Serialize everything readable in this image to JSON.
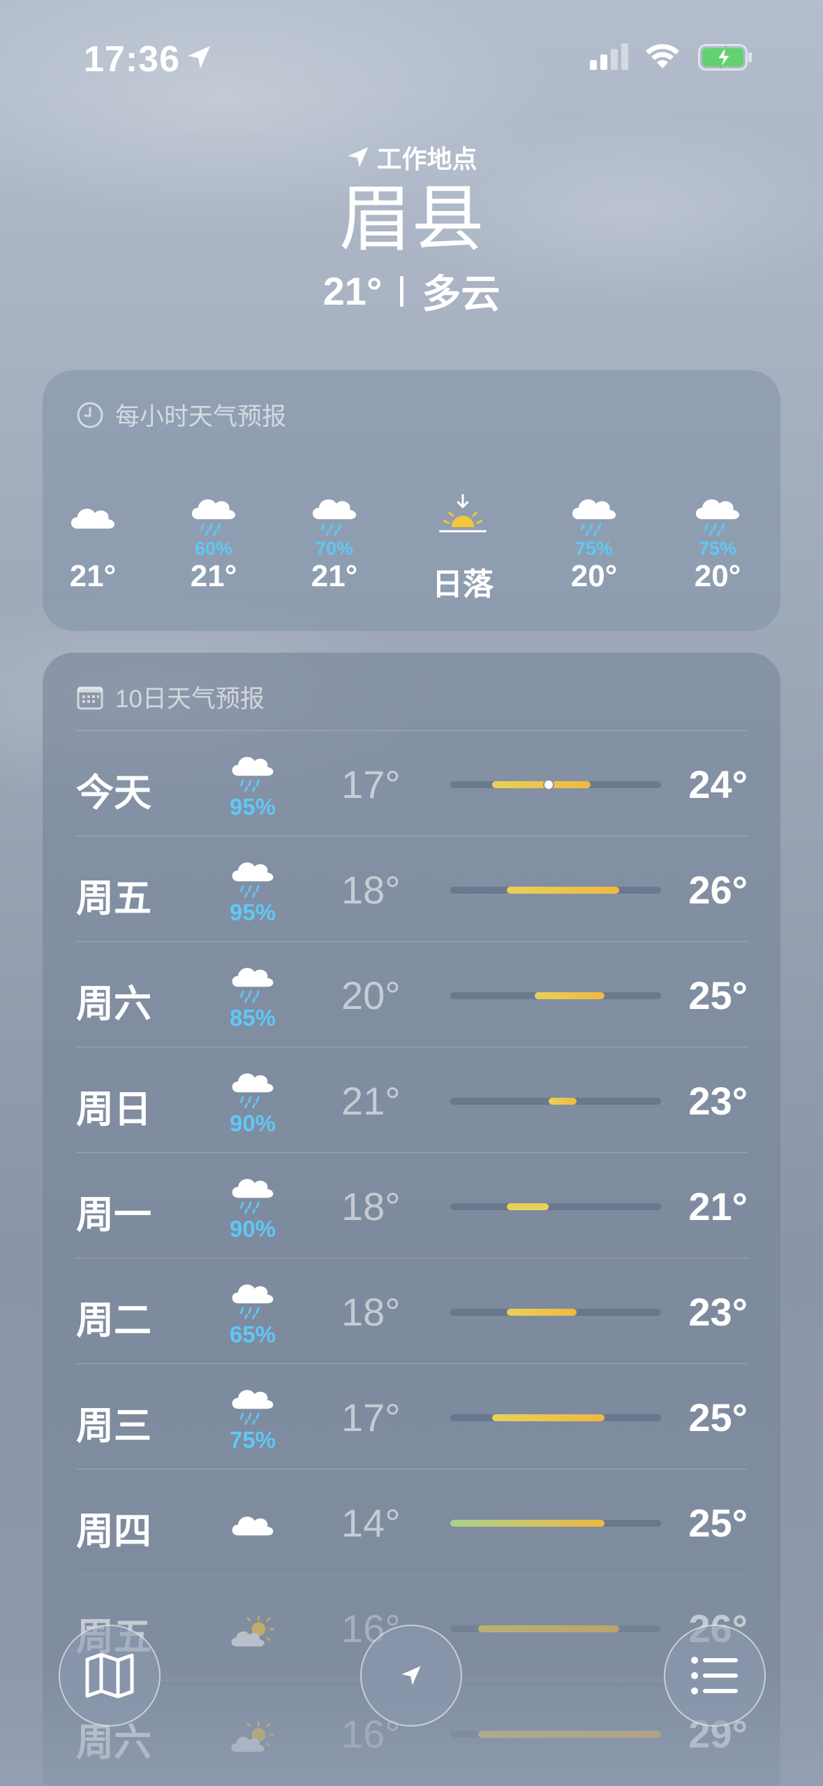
{
  "status_bar": {
    "time": "17:36"
  },
  "header": {
    "location_label": "工作地点",
    "city": "眉县",
    "current_temp": "21°",
    "condition": "多云"
  },
  "hourly": {
    "title": "每小时天气预报",
    "items": [
      {
        "icon": "cloud-icon",
        "pct": "",
        "temp": "21°"
      },
      {
        "icon": "cloud-rain-icon",
        "pct": "60%",
        "temp": "21°"
      },
      {
        "icon": "cloud-rain-icon",
        "pct": "70%",
        "temp": "21°"
      },
      {
        "icon": "sunset-icon",
        "pct": "",
        "temp": "日落"
      },
      {
        "icon": "cloud-rain-icon",
        "pct": "75%",
        "temp": "20°"
      },
      {
        "icon": "cloud-rain-icon",
        "pct": "75%",
        "temp": "20°"
      }
    ]
  },
  "daily": {
    "title": "10日天气预报",
    "range_min": 14,
    "range_max": 29,
    "current_temp_value": 21,
    "rows": [
      {
        "day": "今天",
        "icon": "cloud-rain-icon",
        "pct": "95%",
        "low": "17°",
        "high": "24°",
        "low_v": 17,
        "high_v": 24
      },
      {
        "day": "周五",
        "icon": "cloud-rain-icon",
        "pct": "95%",
        "low": "18°",
        "high": "26°",
        "low_v": 18,
        "high_v": 26
      },
      {
        "day": "周六",
        "icon": "cloud-rain-icon",
        "pct": "85%",
        "low": "20°",
        "high": "25°",
        "low_v": 20,
        "high_v": 25
      },
      {
        "day": "周日",
        "icon": "cloud-rain-icon",
        "pct": "90%",
        "low": "21°",
        "high": "23°",
        "low_v": 21,
        "high_v": 23
      },
      {
        "day": "周一",
        "icon": "cloud-rain-icon",
        "pct": "90%",
        "low": "18°",
        "high": "21°",
        "low_v": 18,
        "high_v": 21
      },
      {
        "day": "周二",
        "icon": "cloud-rain-icon",
        "pct": "65%",
        "low": "18°",
        "high": "23°",
        "low_v": 18,
        "high_v": 23
      },
      {
        "day": "周三",
        "icon": "cloud-rain-icon",
        "pct": "75%",
        "low": "17°",
        "high": "25°",
        "low_v": 17,
        "high_v": 25
      },
      {
        "day": "周四",
        "icon": "cloud-icon",
        "pct": "",
        "low": "14°",
        "high": "25°",
        "low_v": 14,
        "high_v": 25
      },
      {
        "day": "周五",
        "icon": "partly-sunny-icon",
        "pct": "",
        "low": "16°",
        "high": "26°",
        "low_v": 16,
        "high_v": 26
      },
      {
        "day": "周六",
        "icon": "partly-sunny-icon",
        "pct": "",
        "low": "16°",
        "high": "29°",
        "low_v": 16,
        "high_v": 29
      }
    ]
  },
  "colors": {
    "rain_pct": "#5ec8f7",
    "bar_cool": "#a9d08e",
    "bar_mid": "#e8d15a",
    "bar_warm": "#f0b840"
  },
  "toolbar": {
    "map_icon": "map-icon",
    "location_icon": "location-arrow-icon",
    "list_icon": "list-icon"
  }
}
